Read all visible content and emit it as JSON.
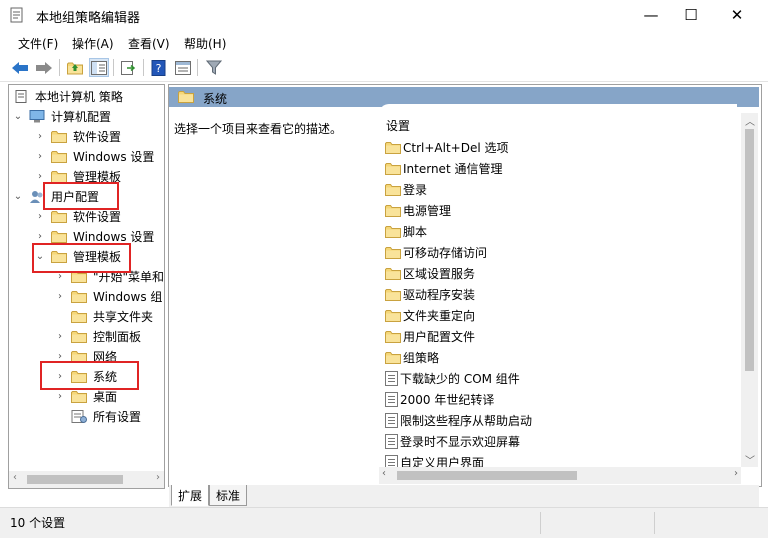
{
  "window": {
    "title": "本地组策略编辑器",
    "min": "—",
    "max": "☐",
    "close": "✕"
  },
  "menu": [
    "文件(F)",
    "操作(A)",
    "查看(V)",
    "帮助(H)"
  ],
  "tree": {
    "root": "本地计算机 策略",
    "computer": "计算机配置",
    "software1": "软件设置",
    "windows1": "Windows 设置",
    "admin1": "管理模板",
    "user": "用户配置",
    "software2": "软件设置",
    "windows2": "Windows 设置",
    "admin2": "管理模板",
    "start": "\"开始\"菜单和",
    "wincomp": "Windows 组",
    "shared": "共享文件夹",
    "control": "控制面板",
    "network": "网络",
    "system": "系统",
    "desktop": "桌面",
    "all": "所有设置"
  },
  "right": {
    "header": "系统",
    "description": "选择一个项目来查看它的描述。",
    "column": "设置",
    "folders": [
      "Ctrl+Alt+Del 选项",
      "Internet 通信管理",
      "登录",
      "电源管理",
      "脚本",
      "可移动存储访问",
      "区域设置服务",
      "驱动程序安装",
      "文件夹重定向",
      "用户配置文件",
      "组策略"
    ],
    "policies": [
      "下载缺少的 COM 组件",
      "2000 年世纪转译",
      "限制这些程序从帮助启动",
      "登录时不显示欢迎屏幕",
      "自定义用户界面"
    ]
  },
  "tabs": [
    "扩展",
    "标准"
  ],
  "status": "10 个设置"
}
